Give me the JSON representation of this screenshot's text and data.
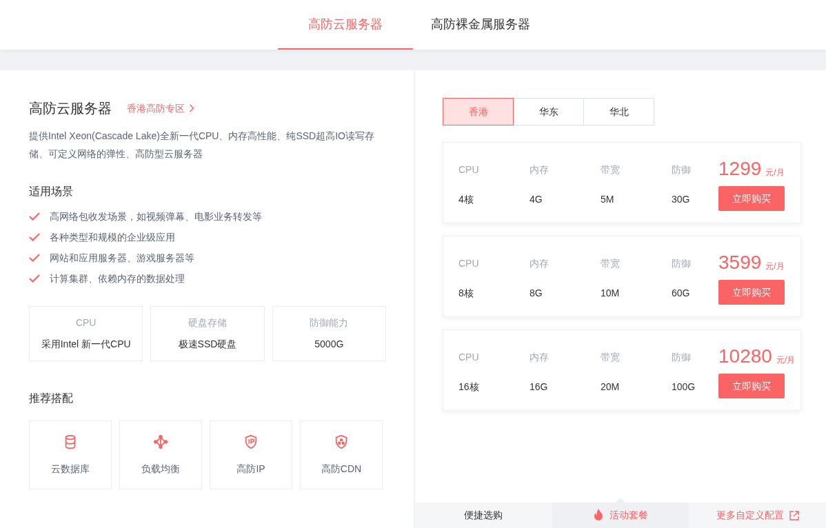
{
  "top_tabs": [
    {
      "label": "高防云服务器",
      "selected": true
    },
    {
      "label": "高防裸金属服务器",
      "selected": false
    }
  ],
  "intro": {
    "title": "高防云服务器",
    "zone_link": "香港高防专区",
    "description": "提供Intel Xeon(Cascade Lake)全新一代CPU、内存高性能、纯SSD超高IO读写存储、可定义网络的弹性、高防型云服务器"
  },
  "scenarios": {
    "heading": "适用场景",
    "items": [
      "高网络包收发场景，如视频弹幕、电影业务转发等",
      "各种类型和规模的企业级应用",
      "网站和应用服务器、游戏服务器等",
      "计算集群、依赖内存的数据处理"
    ]
  },
  "features": [
    {
      "label": "CPU",
      "value": "采用Intel 新一代CPU"
    },
    {
      "label": "硬盘存储",
      "value": "极速SSD硬盘"
    },
    {
      "label": "防御能力",
      "value": "5000G"
    }
  ],
  "recommended": {
    "heading": "推荐搭配",
    "items": [
      "云数据库",
      "负载均衡",
      "高防IP",
      "高防CDN"
    ]
  },
  "regions": [
    {
      "label": "香港",
      "selected": true
    },
    {
      "label": "华东",
      "selected": false
    },
    {
      "label": "华北",
      "selected": false
    }
  ],
  "plans": [
    {
      "specs": [
        {
          "label": "CPU",
          "value": "4核"
        },
        {
          "label": "内存",
          "value": "4G"
        },
        {
          "label": "带宽",
          "value": "5M"
        },
        {
          "label": "防御",
          "value": "30G"
        }
      ],
      "price": "1299",
      "unit": "元/月",
      "button": "立即购买"
    },
    {
      "specs": [
        {
          "label": "CPU",
          "value": "8核"
        },
        {
          "label": "内存",
          "value": "8G"
        },
        {
          "label": "带宽",
          "value": "10M"
        },
        {
          "label": "防御",
          "value": "60G"
        }
      ],
      "price": "3599",
      "unit": "元/月",
      "button": "立即购买"
    },
    {
      "specs": [
        {
          "label": "CPU",
          "value": "16核"
        },
        {
          "label": "内存",
          "value": "16G"
        },
        {
          "label": "带宽",
          "value": "20M"
        },
        {
          "label": "防御",
          "value": "100G"
        }
      ],
      "price": "10280",
      "unit": "元/月",
      "button": "立即购买"
    }
  ],
  "bottom_tabs": [
    {
      "label": "便捷选购",
      "kind": "plain",
      "selected": false
    },
    {
      "label": "活动套餐",
      "kind": "hot",
      "selected": true
    },
    {
      "label": "更多自定义配置",
      "kind": "link",
      "selected": false
    }
  ]
}
